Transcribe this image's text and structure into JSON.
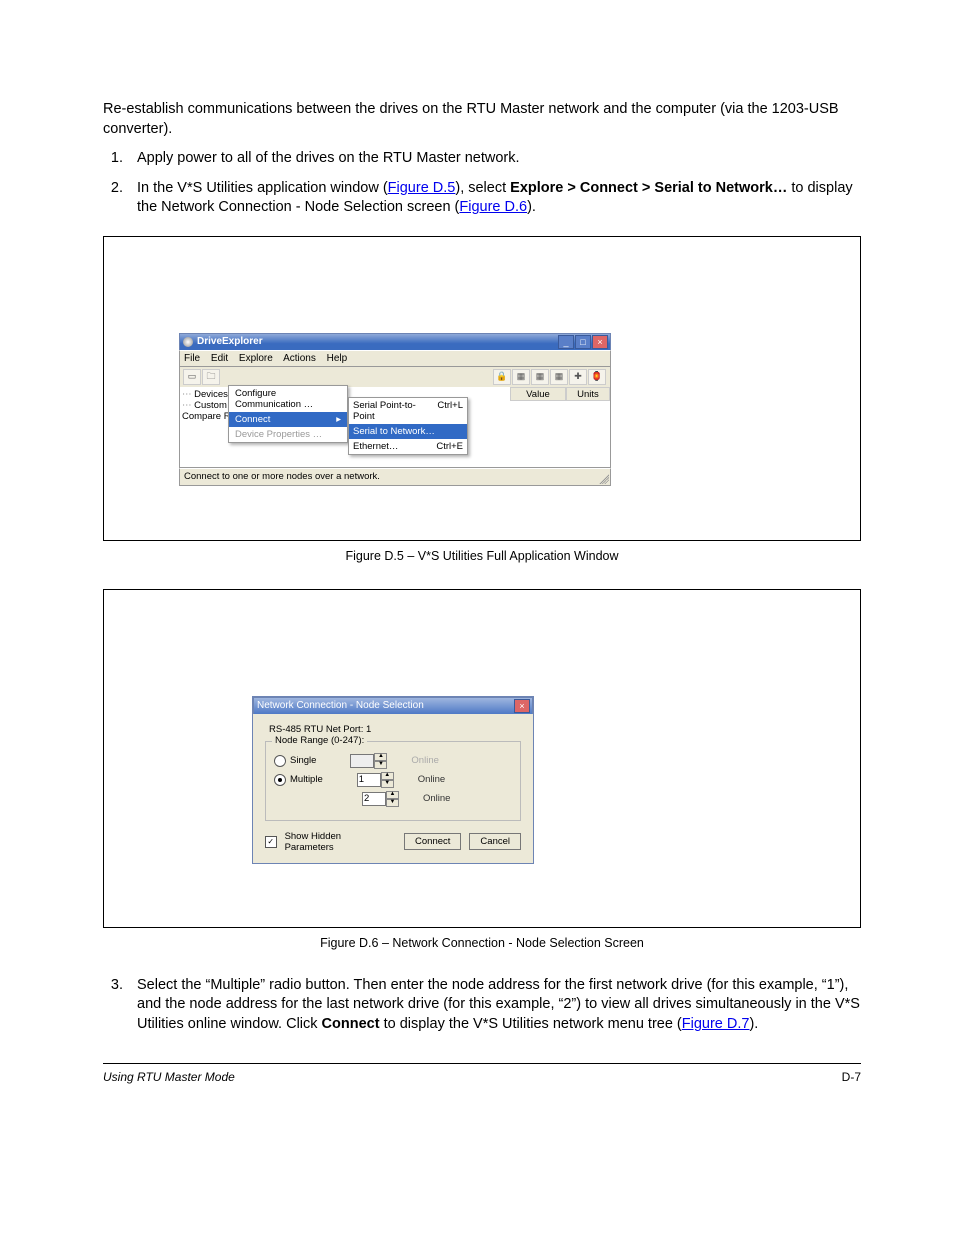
{
  "intro_paragraph": "Re-establish communications between the drives on the RTU Master network and the computer (via the 1203-USB converter).",
  "steps": {
    "s1": "Apply power to all of the drives on the RTU Master network.",
    "s2": {
      "pre": "In the V*S Utilities application window (",
      "link1": "Figure D.5",
      "mid1": "), select ",
      "bold": "Explore > Connect > Serial to Network…",
      "mid2": " to display the Network Connection - Node Selection screen (",
      "link2": "Figure D.6",
      "post": ")."
    },
    "s3": {
      "pre": "Select the “Multiple” radio button. Then enter the node address for the first network drive (for this example, “1”), and the node address for the last network drive (for this example, “2”) to view all drives simultaneously in the V*S Utilities online window. Click ",
      "bold": "Connect",
      "mid": " to display the V*S Utilities network menu tree (",
      "link": "Figure D.7",
      "post": ")."
    }
  },
  "figure_d5": {
    "caption": "Figure D.5 –  V*S Utilities Full Application Window",
    "title": "DriveExplorer",
    "menus": {
      "m1": "File",
      "m2": "Edit",
      "m3": "Explore",
      "m4": "Actions",
      "m5": "Help"
    },
    "explore_menu": {
      "i1": "Configure Communication …",
      "i2": "Connect",
      "i3": "Device Properties …"
    },
    "connect_submenu": {
      "r1": {
        "label": "Serial Point-to-Point",
        "accel": "Ctrl+L"
      },
      "r2": {
        "label": "Serial to Network…",
        "accel": ""
      },
      "r3": {
        "label": "Ethernet…",
        "accel": "Ctrl+E"
      }
    },
    "tree": {
      "t1": "Devices",
      "t2": "Custom",
      "t3": "Compare Results"
    },
    "list_headers": {
      "h1": "Value",
      "h2": "Units"
    },
    "status": "Connect to one or more nodes over a network."
  },
  "figure_d6": {
    "caption": "Figure D.6 –  Network Connection - Node Selection Screen",
    "title": "Network Connection - Node Selection",
    "port_line": "RS-485 RTU Net  Port: 1",
    "legend": "Node Range (0-247):",
    "radio_single": "Single",
    "radio_multiple": "Multiple",
    "val_single": "",
    "val_from": "1",
    "val_to": "2",
    "online": "Online",
    "checkbox": "Show Hidden Parameters",
    "btn_connect": "Connect",
    "btn_cancel": "Cancel"
  },
  "footer": {
    "left": "Using RTU Master Mode",
    "right": "D-7"
  }
}
